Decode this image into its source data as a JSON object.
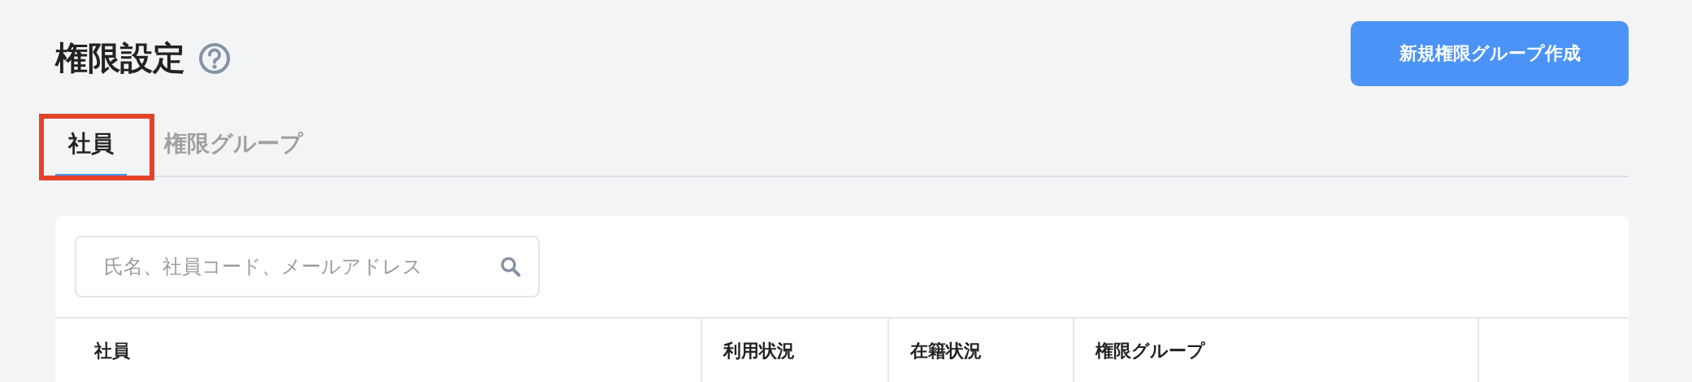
{
  "page": {
    "title": "権限設定",
    "primary_button": "新規権限グループ作成"
  },
  "tabs": [
    {
      "label": "社員",
      "selected": true,
      "highlighted": true
    },
    {
      "label": "権限グループ",
      "selected": false,
      "highlighted": false
    }
  ],
  "search": {
    "placeholder": "氏名、社員コード、メールアドレス"
  },
  "table": {
    "columns": [
      "社員",
      "利用状況",
      "在籍状況",
      "権限グループ",
      ""
    ]
  }
}
